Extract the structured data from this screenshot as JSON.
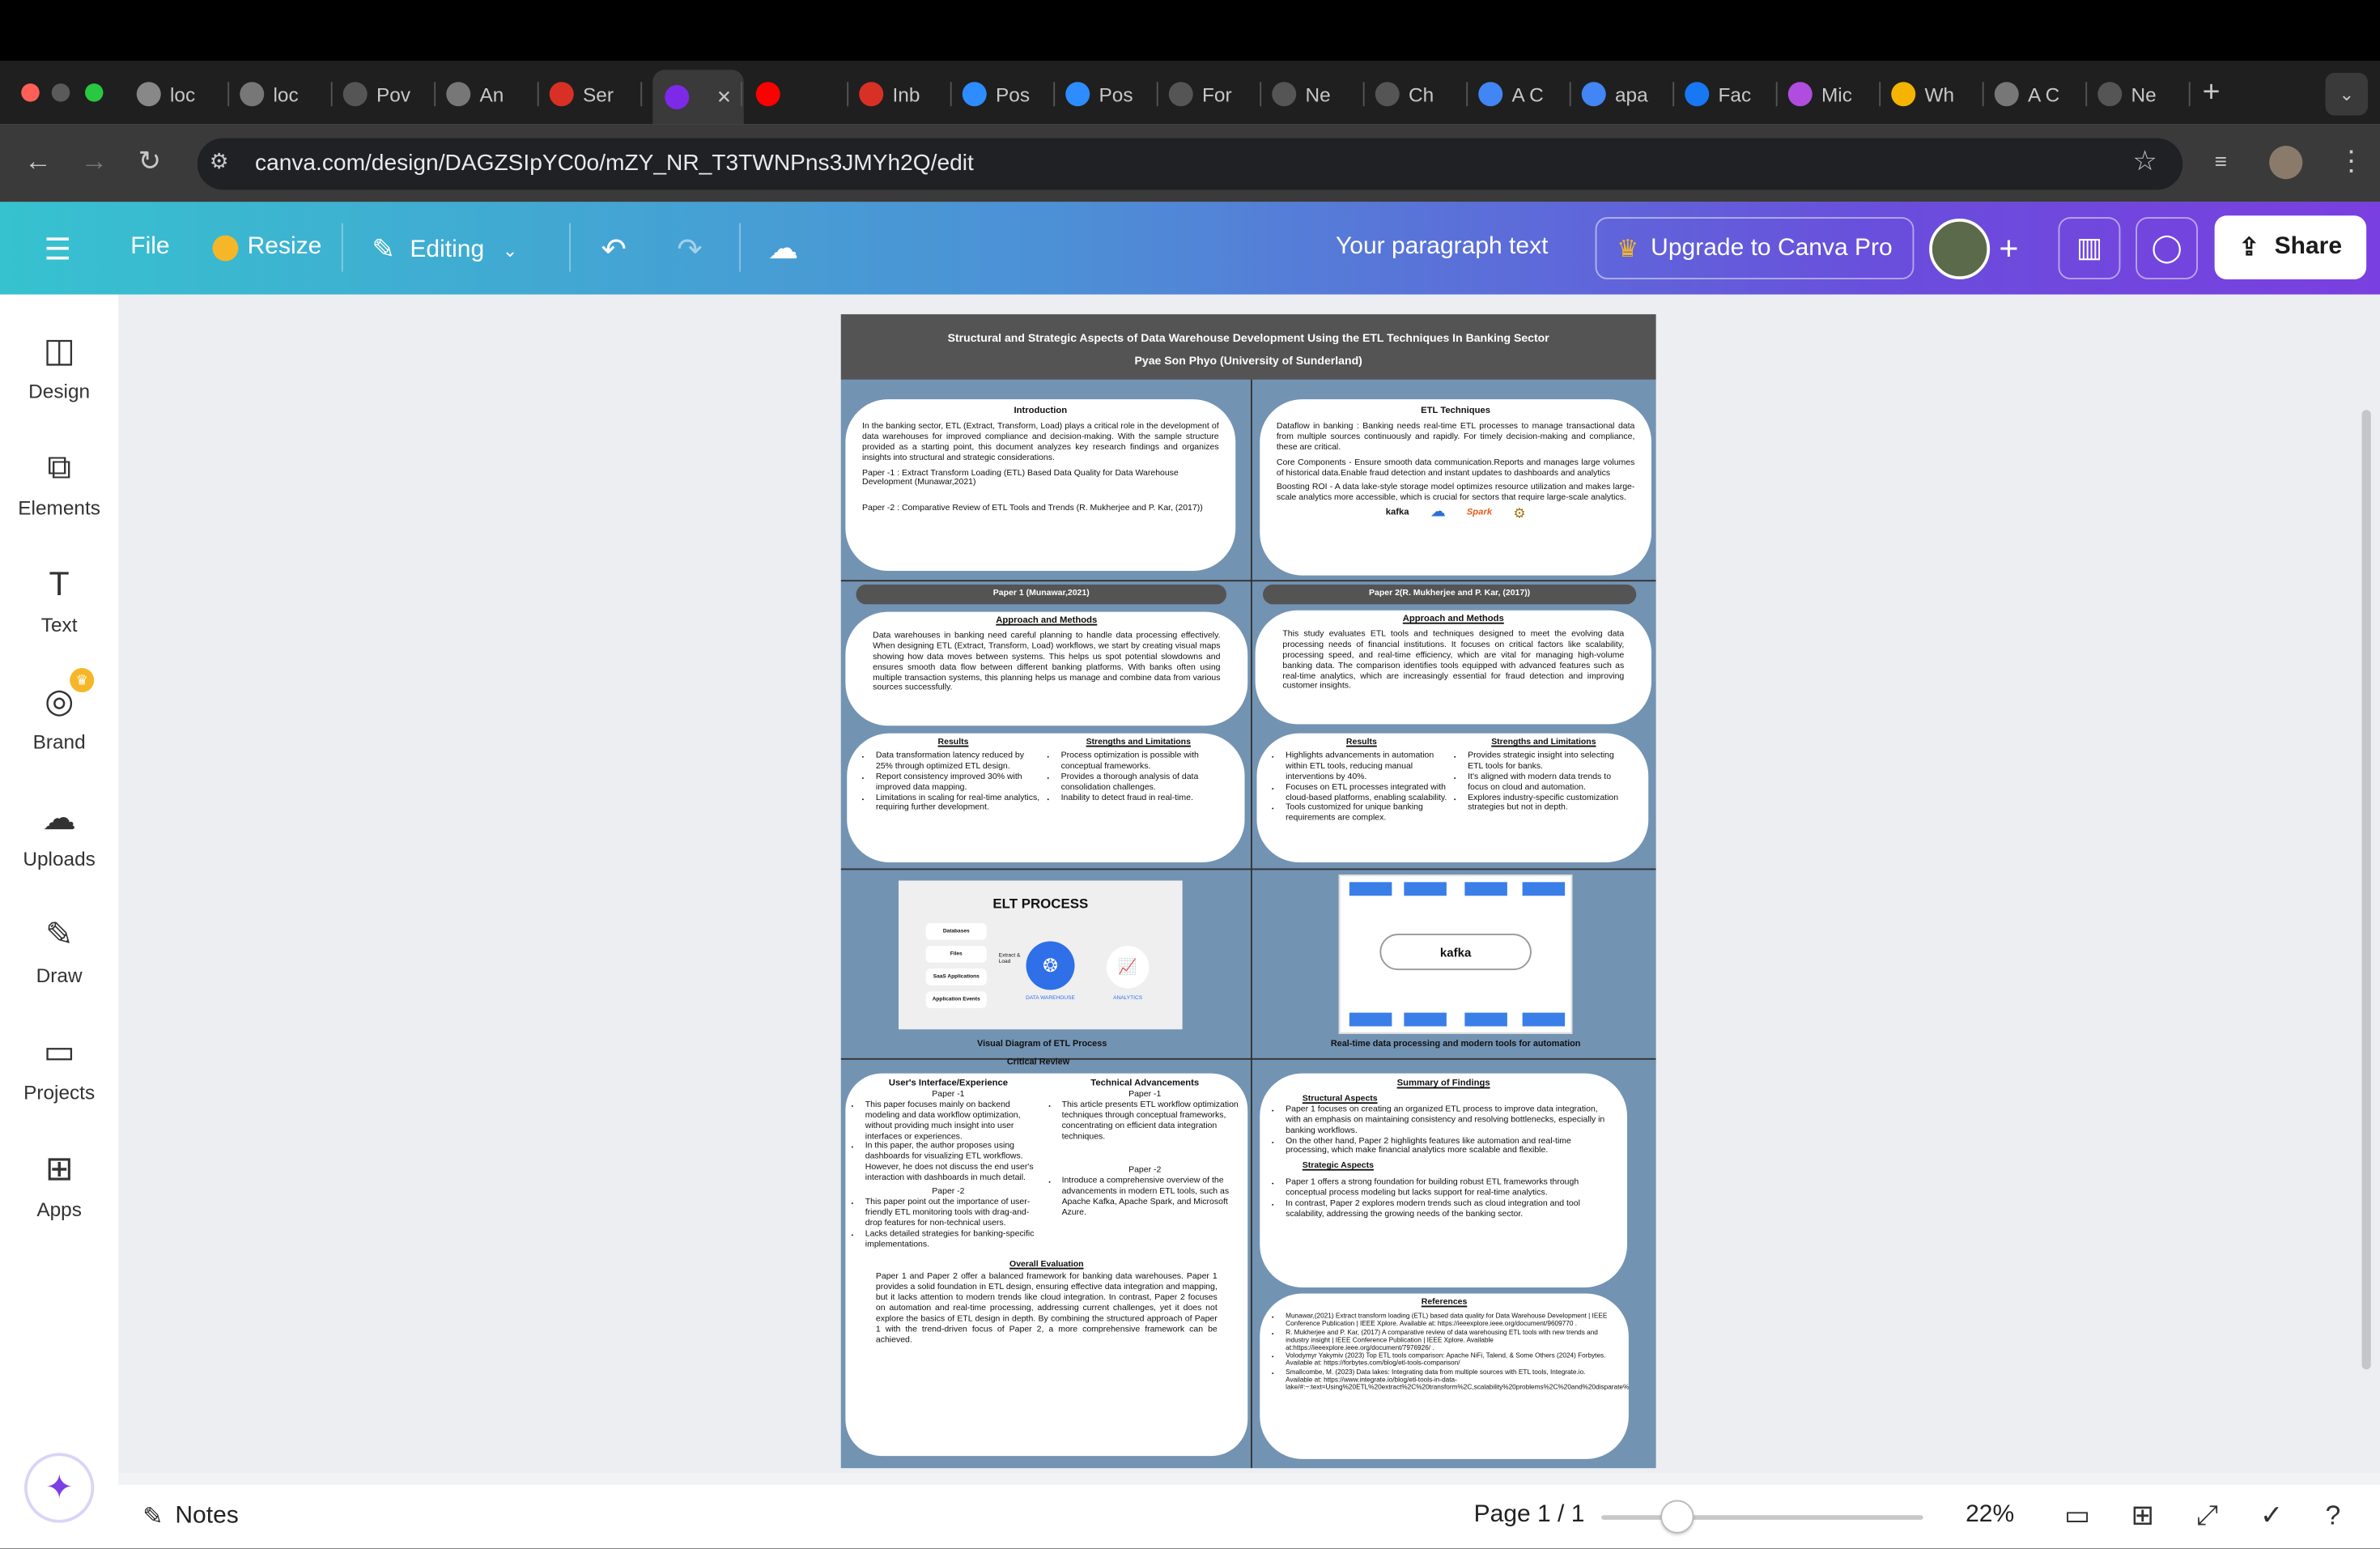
{
  "browser": {
    "tabs": [
      {
        "label": "loc",
        "icon": "ollama-icon"
      },
      {
        "label": "loc",
        "icon": "globe-icon"
      },
      {
        "label": "Pov",
        "icon": "openai-icon"
      },
      {
        "label": "An",
        "icon": "globe-icon"
      },
      {
        "label": "Ser",
        "icon": "gmail-icon"
      },
      {
        "label": "",
        "icon": "canva-icon"
      },
      {
        "label": "",
        "icon": "youtube-icon"
      },
      {
        "label": "Inb",
        "icon": "gmail-icon"
      },
      {
        "label": "Pos",
        "icon": "zoom-icon"
      },
      {
        "label": "Pos",
        "icon": "zoom-icon"
      },
      {
        "label": "For",
        "icon": "openai-icon"
      },
      {
        "label": "Ne",
        "icon": "openai-icon"
      },
      {
        "label": "Ch",
        "icon": "openai-icon"
      },
      {
        "label": "A C",
        "icon": "google-icon"
      },
      {
        "label": "apa",
        "icon": "google-icon"
      },
      {
        "label": "Fac",
        "icon": "facebook-icon"
      },
      {
        "label": "Mic",
        "icon": "copilot-icon"
      },
      {
        "label": "Wh",
        "icon": "drive-icon"
      },
      {
        "label": "A C",
        "icon": "globe-icon"
      },
      {
        "label": "Ne",
        "icon": "openai-icon"
      }
    ],
    "url": "canva.com/design/DAGZSIpYC0o/mZY_NR_T3TWNPns3JMYh2Q/edit"
  },
  "header": {
    "file": "File",
    "resize": "Resize",
    "editing": "Editing",
    "paragraph": "Your paragraph text",
    "upgrade": "Upgrade to Canva Pro",
    "share": "Share"
  },
  "sidebar": {
    "items": [
      {
        "label": "Design"
      },
      {
        "label": "Elements"
      },
      {
        "label": "Text"
      },
      {
        "label": "Brand"
      },
      {
        "label": "Uploads"
      },
      {
        "label": "Draw"
      },
      {
        "label": "Projects"
      },
      {
        "label": "Apps"
      }
    ]
  },
  "poster": {
    "title": "Structural and Strategic Aspects of Data Warehouse Development Using the ETL Techniques In Banking Sector",
    "author": "Pyae Son Phyo (University of Sunderland)",
    "intro": {
      "heading": "Introduction",
      "body": "In the banking sector, ETL (Extract, Transform, Load) plays a critical role in the development of data warehouses for improved compliance and decision-making. With the sample structure provided as a starting point, this document analyzes key research findings and organizes insights into structural and strategic considerations.",
      "paper1": "Paper -1 : Extract Transform Loading (ETL) Based Data Quality for Data Warehouse Development (Munawar,2021)",
      "paper2": "Paper -2 : Comparative Review of ETL Tools and Trends (R. Mukherjee and P. Kar, (2017))"
    },
    "etl": {
      "heading": "ETL Techniques",
      "p1": "Dataflow in banking : Banking needs real-time ETL processes to manage transactional data from multiple sources continuously and rapidly. For timely decision-making and compliance, these are critical.",
      "p2": "Core Components - Ensure smooth data communication.Reports and manages large volumes of historical data.Enable fraud detection and instant updates to dashboards and analytics",
      "p3": "Boosting ROI - A data lake-style storage model optimizes resource utilization and makes large-scale analytics more accessible, which is crucial for sectors that require large-scale analytics.",
      "logos": [
        "kafka",
        "cloud",
        "Spark",
        "etl"
      ]
    },
    "paper1": {
      "pill": "Paper 1 (Munawar,2021)",
      "approach_heading": "Approach and Methods",
      "approach": "Data warehouses in banking need careful planning to handle data processing effectively. When designing ETL (Extract, Transform, Load) workflows, we start by creating visual maps showing how data moves between systems. This helps us spot potential slowdowns and ensures smooth data flow between different banking platforms. With banks often using multiple transaction systems, this planning helps us manage and combine data from various sources successfully.",
      "results_heading": "Results",
      "results": [
        "Data transformation latency reduced by 25% through optimized ETL design.",
        "Report consistency improved 30% with improved data mapping.",
        "Limitations in scaling for real-time analytics, requiring further development."
      ],
      "sl_heading": "Strengths and Limitations",
      "sl": [
        "Process optimization is possible with conceptual frameworks.",
        "Provides a thorough analysis of data consolidation challenges.",
        "Inability to detect fraud in real-time."
      ]
    },
    "paper2": {
      "pill": "Paper 2(R. Mukherjee and P. Kar, (2017))",
      "approach_heading": "Approach and Methods",
      "approach": "This study evaluates ETL tools and techniques designed to meet the evolving data processing needs of financial institutions. It focuses on critical factors like scalability, processing speed, and real-time efficiency, which are vital for managing high-volume banking data. The comparison identifies tools equipped with advanced features such as real-time analytics, which are increasingly essential for fraud detection and improving customer insights.",
      "results_heading": "Results",
      "results": [
        "Highlights advancements in automation within ETL tools, reducing manual interventions by 40%.",
        "Focuses on ETL processes integrated with cloud-based platforms, enabling scalability.",
        "Tools customized for unique banking requirements are complex."
      ],
      "sl_heading": "Strengths and Limitations",
      "sl": [
        "Provides strategic insight into selecting ETL tools for banks.",
        "It's aligned with modern data trends to focus on cloud and automation.",
        "Explores industry-specific customization strategies but not in depth."
      ]
    },
    "diagram1": {
      "title": "ELT PROCESS",
      "sources": [
        "Databases",
        "Files",
        "SaaS Applications",
        "Application Events"
      ],
      "mid_label": "Extract & Load",
      "core": "DATA WAREHOUSE",
      "right_label": "ANALYTICS",
      "caption": "Visual Diagram of ETL Process"
    },
    "diagram2": {
      "core": "kafka",
      "caption": "Real-time data processing and modern tools for automation"
    },
    "critical": {
      "banner": "Critical Review",
      "ui_heading": "User's Interface/Experience",
      "ui_p1": "Paper -1",
      "ui_list1": [
        "This paper focuses mainly on backend modeling and data workflow optimization, without providing much insight into user interfaces or experiences.",
        "In this paper, the author proposes using dashboards for visualizing ETL workflows. However, he does not discuss the end user's interaction with dashboards in much detail."
      ],
      "ui_p2": "Paper -2",
      "ui_list2": [
        "This paper point out the importance of user-friendly ETL monitoring tools with drag-and-drop features for non-technical users.",
        "Lacks detailed strategies for banking-specific implementations."
      ],
      "tech_heading": "Technical Advancements",
      "tech_p1": "Paper -1",
      "tech_list1": [
        "This article presents ETL workflow optimization techniques through conceptual frameworks, concentrating on efficient data integration techniques."
      ],
      "tech_p2": "Paper -2",
      "tech_list2": [
        "Introduce a comprehensive overview of the advancements in modern ETL tools, such as Apache Kafka, Apache Spark, and Microsoft Azure."
      ],
      "eval_heading": "Overall Evaluation",
      "eval": "Paper 1 and Paper 2 offer a balanced framework for banking data warehouses. Paper 1 provides a solid foundation in ETL design, ensuring effective data integration and mapping, but it lacks attention to modern trends like cloud integration. In contrast, Paper 2 focuses on automation and real-time processing, addressing current challenges, yet it does not explore the basics of ETL design in depth. By combining the structured approach of Paper 1 with the trend-driven focus of Paper 2, a more comprehensive framework can be achieved."
    },
    "summary": {
      "heading": "Summary of Findings",
      "structural": "Structural Aspects",
      "structural_list": [
        "Paper 1 focuses on creating an organized ETL process to improve data integration, with an emphasis on maintaining consistency and resolving bottlenecks, especially in banking workflows.",
        "On the other hand, Paper 2 highlights features like automation and real-time processing, which make financial analytics more scalable and flexible."
      ],
      "strategic": "Strategic Aspects",
      "strategic_list": [
        "Paper 1 offers a strong foundation for building robust ETL frameworks through conceptual process modeling but lacks support for real-time analytics.",
        "In contrast, Paper 2 explores modern trends such as cloud integration and tool scalability, addressing the growing needs of the banking sector."
      ]
    },
    "references": {
      "heading": "References",
      "items": [
        "Munawar,(2021) Extract transform loading (ETL) based data quality for Data Warehouse Development | IEEE Conference Publication | IEEE Xplore. Available at: https://ieeexplore.ieee.org/document/9609770 .",
        "R. Mukherjee and P. Kar, (2017) A comparative review of data warehousing ETL tools with new trends and industry insight | IEEE Conference Publication | IEEE Xplore. Available at:https://ieeexplore.ieee.org/document/7976926/ .",
        "Volodymyr Yakymiv (2023) Top ETL tools comparison: Apache NiFi, Talend, & Some Others (2024) Forbytes. Available at: https://forbytes.com/blog/etl-tools-comparison/",
        "Smallcombe, M. (2023) Data lakes: Integrating data from multiple sources with ETL tools, Integrate.io. Available at: https://www.integrate.io/blog/etl-tools-in-data-lake/#:~:text=Using%20ETL%20extract%2C%20transform%2C,scalability%20problems%2C%20and%20disparate%20formats."
      ]
    }
  },
  "bottom": {
    "notes": "Notes",
    "page": "Page 1 / 1",
    "zoom": "22%",
    "zoom_level": 0.22
  }
}
